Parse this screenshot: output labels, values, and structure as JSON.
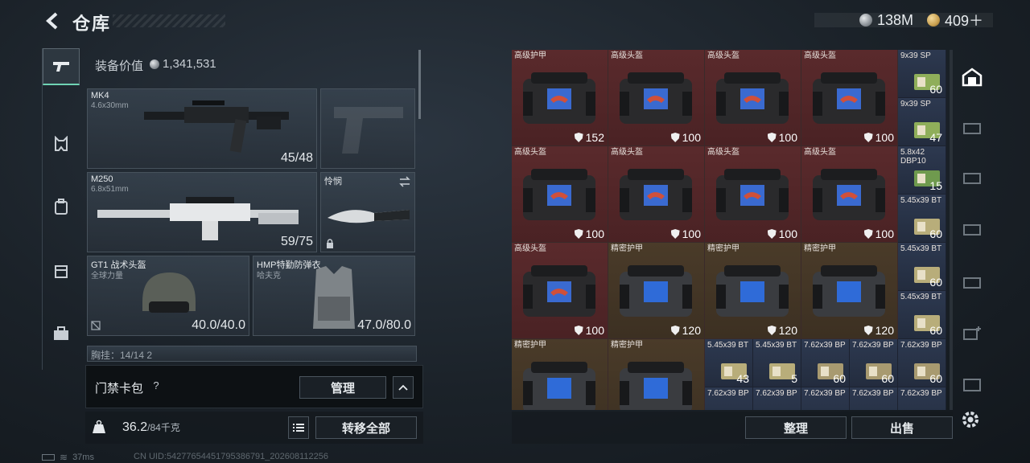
{
  "header": {
    "title": "仓库",
    "currency_silver": "138M",
    "currency_gold": "409＋"
  },
  "loadout": {
    "value_label": "装备价值",
    "value": "1,341,531",
    "primary": {
      "name": "MK4",
      "caliber": "4.6x30mm",
      "ammo": "45/48"
    },
    "secondary": {
      "name": "M250",
      "caliber": "6.8x51mm",
      "ammo": "59/75"
    },
    "melee": {
      "name": "怜悯"
    },
    "helmet": {
      "name": "GT1 战术头盔",
      "brand": "全球力量",
      "durability": "40.0/40.0"
    },
    "armor": {
      "name": "HMP特勤防弹衣",
      "brand": "哈夫克",
      "durability": "47.0/80.0"
    },
    "chest_partial": "胸挂：14/14  2"
  },
  "keycard": {
    "label": "门禁卡包",
    "help": "?",
    "manage": "管理"
  },
  "footer": {
    "weight": "36.2",
    "weight_max": "/84千克",
    "transfer_all": "转移全部"
  },
  "status": {
    "ping": "37ms",
    "uid": "CN UID:5427765445179538679​1_202608112256"
  },
  "stash": {
    "big": [
      {
        "name": "高级护甲",
        "value": "152",
        "kind": "red"
      },
      {
        "name": "高级头盔",
        "value": "100",
        "kind": "red"
      },
      {
        "name": "高级头盔",
        "value": "100",
        "kind": "red"
      },
      {
        "name": "高级头盔",
        "value": "100",
        "kind": "red"
      },
      {
        "name": "高级头盔",
        "value": "100",
        "kind": "red"
      },
      {
        "name": "高级头盔",
        "value": "100",
        "kind": "red"
      },
      {
        "name": "高级头盔",
        "value": "100",
        "kind": "red"
      },
      {
        "name": "高级头盔",
        "value": "100",
        "kind": "red"
      },
      {
        "name": "高级头盔",
        "value": "100",
        "kind": "red"
      },
      {
        "name": "精密护甲",
        "value": "120",
        "kind": "gold"
      },
      {
        "name": "精密护甲",
        "value": "120",
        "kind": "gold"
      },
      {
        "name": "精密护甲",
        "value": "120",
        "kind": "gold"
      },
      {
        "name": "精密护甲",
        "value": "",
        "kind": "gold"
      },
      {
        "name": "精密护甲",
        "value": "",
        "kind": "gold"
      }
    ],
    "side_ammo": [
      {
        "name": "9x39 SP",
        "value": "60"
      },
      {
        "name": "9x39 SP",
        "value": "47"
      },
      {
        "name": "5.8x42 DBP10",
        "value": "15"
      },
      {
        "name": "5.45x39 BT",
        "value": "60"
      },
      {
        "name": "5.45x39 BT",
        "value": "60"
      },
      {
        "name": "5.45x39 BT",
        "value": "60"
      }
    ],
    "bottom_ammo": [
      {
        "name": "5.45x39 BT",
        "value": "43"
      },
      {
        "name": "5.45x39 BT",
        "value": "5"
      },
      {
        "name": "7.62x39 BP",
        "value": "60"
      },
      {
        "name": "7.62x39 BP",
        "value": "60"
      },
      {
        "name": "7.62x39 BP",
        "value": "60"
      }
    ],
    "bottom_ammo2": [
      "7.62x39 BP",
      "7.62x39 BP",
      "7.62x39 BP",
      "7.62x39 BP",
      "7.62x39 BP"
    ],
    "sort": "整理",
    "sell": "出售"
  },
  "colors": {
    "accent": "#6fd3b4",
    "red_cell": "#5a2a2c",
    "gold_cell": "#4a3b29",
    "blue_cell": "#2d3950"
  }
}
